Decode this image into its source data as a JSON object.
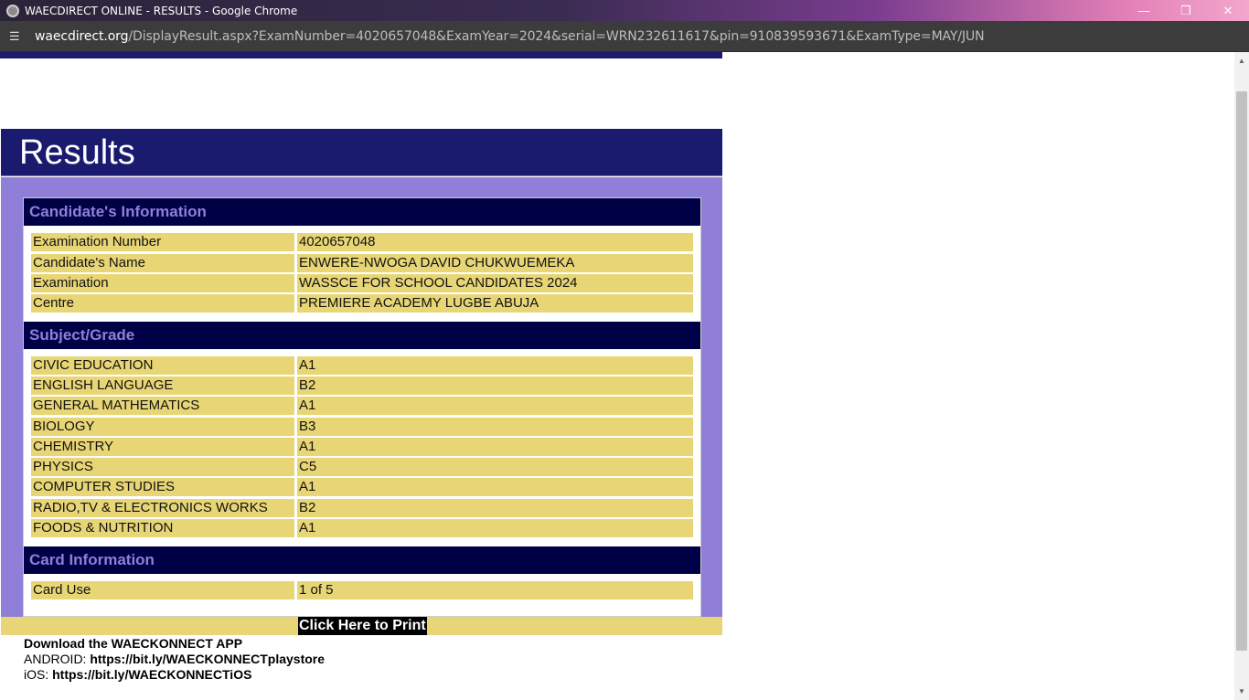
{
  "window": {
    "title": "WAECDIRECT ONLINE - RESULTS - Google Chrome",
    "minimize_icon": "minimize-icon",
    "maximize_icon": "restore-icon",
    "close_icon": "close-icon"
  },
  "address": {
    "host": "waecdirect.org",
    "path": "/DisplayResult.aspx?ExamNumber=4020657048&ExamYear=2024&serial=WRN232611617&pin=910839593671&ExamType=MAY/JUN"
  },
  "page": {
    "heading": "Results",
    "candidate_section": "Candidate's Information",
    "candidate_rows": [
      {
        "label": "Examination Number",
        "value": "4020657048"
      },
      {
        "label": "Candidate's Name",
        "value": "ENWERE-NWOGA DAVID CHUKWUEMEKA"
      },
      {
        "label": "Examination",
        "value": "WASSCE FOR SCHOOL CANDIDATES 2024"
      },
      {
        "label": "Centre",
        "value": "PREMIERE ACADEMY LUGBE ABUJA"
      }
    ],
    "subject_section": "Subject/Grade",
    "subject_rows": [
      {
        "subject": "CIVIC EDUCATION",
        "grade": "A1"
      },
      {
        "subject": "ENGLISH LANGUAGE",
        "grade": "B2"
      },
      {
        "subject": "GENERAL MATHEMATICS",
        "grade": "A1"
      },
      {
        "subject": "BIOLOGY",
        "grade": "B3"
      },
      {
        "subject": "CHEMISTRY",
        "grade": "A1"
      },
      {
        "subject": "PHYSICS",
        "grade": "C5"
      },
      {
        "subject": "COMPUTER STUDIES",
        "grade": "A1"
      },
      {
        "subject": "RADIO,TV & ELECTRONICS WORKS",
        "grade": "B2"
      },
      {
        "subject": "FOODS & NUTRITION",
        "grade": "A1"
      }
    ],
    "card_section": "Card Information",
    "card_rows": [
      {
        "label": "Card Use",
        "value": "1 of 5"
      }
    ],
    "print_label": "Click Here to Print",
    "download": {
      "title": "Download the WAECKONNECT APP",
      "android_label": "ANDROID: ",
      "android_link": "https://bit.ly/WAECKONNECTplaystore",
      "ios_label": "iOS: ",
      "ios_link": "https://bit.ly/WAECKONNECTiOS"
    }
  },
  "colors": {
    "header_navy": "#1a1a6e",
    "section_navy": "#000046",
    "panel_purple": "#8f7fd9",
    "row_gold": "#e8d676"
  }
}
